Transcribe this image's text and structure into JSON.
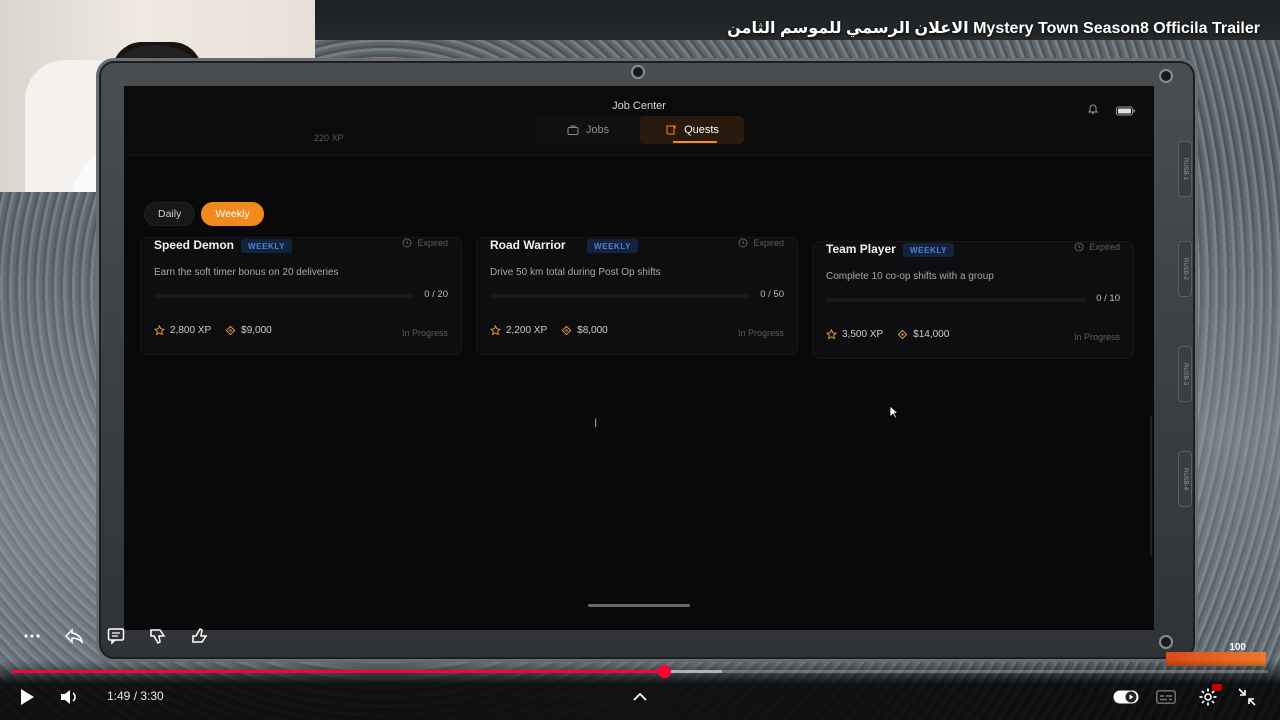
{
  "video": {
    "title": "الاعلان الرسمي للموسم الثامن Mystery Town Season8 Officila Trailer"
  },
  "app": {
    "title": "Job Center",
    "xp_ghost": "220 XP",
    "tabs": [
      {
        "label": "Jobs",
        "icon": "briefcase-icon",
        "active": false
      },
      {
        "label": "Quests",
        "icon": "scroll-icon",
        "active": true
      }
    ],
    "filters": [
      {
        "label": "Daily",
        "active": false
      },
      {
        "label": "Weekly",
        "active": true
      }
    ],
    "accent_color": "#f08a1c",
    "badge_color": "#4d82d8"
  },
  "quests": [
    {
      "title": "Speed Demon",
      "badge": "WEEKLY",
      "status": "Expired",
      "description": "Earn the soft timer bonus on 20 deliveries",
      "progress": 0,
      "count": "0 / 20",
      "xp": "2,800 XP",
      "money": "$9,000",
      "state": "In Progress"
    },
    {
      "title": "Road Warrior",
      "badge": "WEEKLY",
      "status": "Expired",
      "description": "Drive 50 km total during Post Op shifts",
      "progress": 0,
      "count": "0 / 50",
      "xp": "2,200 XP",
      "money": "$8,000",
      "state": "In Progress"
    },
    {
      "title": "Team Player",
      "badge": "WEEKLY",
      "status": "Expired",
      "description": "Complete 10 co-op shifts with a group",
      "progress": 0,
      "count": "0 / 10",
      "xp": "3,500 XP",
      "money": "$14,000",
      "state": "In Progress"
    }
  ],
  "hud": {
    "value": "100"
  },
  "player": {
    "time": "1:49 / 3:30",
    "played_fraction": 0.519,
    "buffered_fraction": 0.565,
    "progress_color": "#ff0033"
  },
  "side_tabs": [
    "RUSB-1",
    "RUSB-2",
    "RUSB-3",
    "RUSB-4"
  ]
}
